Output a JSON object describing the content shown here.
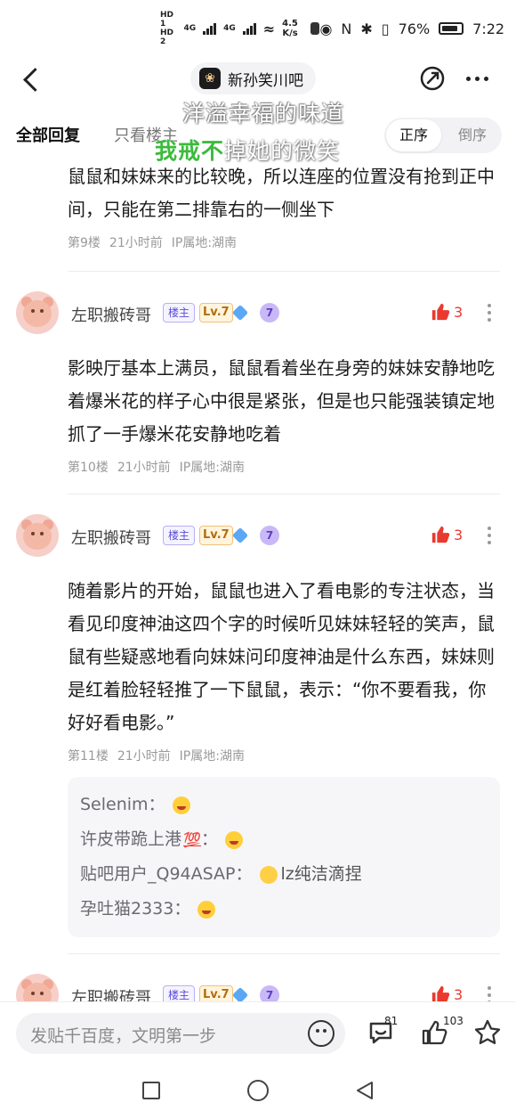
{
  "status_bar": {
    "hd1": "HD 1",
    "hd2": "HD 2",
    "net1": "4G",
    "net2": "4G",
    "speed_value": "4.5",
    "speed_unit": "K/s",
    "battery": "76%",
    "time": "7:22"
  },
  "nav": {
    "forum_name": "新孙笑川吧"
  },
  "tabs": {
    "all_replies": "全部回复",
    "only_lz": "只看楼主",
    "sort_asc": "正序",
    "sort_desc": "倒序"
  },
  "overlay": {
    "line1": "洋溢幸福的味道",
    "line2_highlight": "我戒不",
    "line2_rest": "掉她的微笑"
  },
  "posts": [
    {
      "text": "鼠鼠和妹妹来的比较晚，所以连座的位置没有抢到正中间，只能在第二排靠右的一侧坐下",
      "floor": "第9楼",
      "time": "21小时前",
      "ip": "IP属地:湖南"
    },
    {
      "username": "左职搬砖哥",
      "badge_lz": "楼主",
      "level": "Lv.7",
      "badge_seven": "7",
      "likes": "3",
      "text": "影映厅基本上满员，鼠鼠看着坐在身旁的妹妹安静地吃着爆米花的样子心中很是紧张，但是也只能强装镇定地抓了一手爆米花安静地吃着",
      "floor": "第10楼",
      "time": "21小时前",
      "ip": "IP属地:湖南"
    },
    {
      "username": "左职搬砖哥",
      "badge_lz": "楼主",
      "level": "Lv.7",
      "badge_seven": "7",
      "likes": "3",
      "text": "随着影片的开始，鼠鼠也进入了看电影的专注状态，当看见印度神油这四个字的时候听见妹妹轻轻的笑声，鼠鼠有些疑惑地看向妹妹问印度神油是什么东西，妹妹则是红着脸轻轻推了一下鼠鼠，表示：“你不要看我，你好好看电影。”",
      "floor": "第11楼",
      "time": "21小时前",
      "ip": "IP属地:湖南",
      "replies": [
        {
          "user": "Selenim：",
          "content": ""
        },
        {
          "user": "许皮带跪上港",
          "badge": "💯",
          "sep": "：",
          "content": ""
        },
        {
          "user": "贴吧用户_Q94ASAP：",
          "content": "lz纯洁滴捏"
        },
        {
          "user": "孕吐猫2333：",
          "content": ""
        }
      ]
    },
    {
      "username": "左职搬砖哥",
      "badge_lz": "楼主",
      "level": "Lv.7",
      "badge_seven": "7",
      "likes": "3"
    }
  ],
  "bottom_bar": {
    "placeholder": "发贴千百度，文明第一步",
    "comment_count": "81",
    "like_count": "103"
  },
  "colors": {
    "like_red": "#ea3a2f",
    "overlay_green": "#3cbb3c",
    "lz_badge": "#5b4bd6",
    "level_badge": "#b46c10"
  },
  "icons": [
    "back-icon",
    "share-icon",
    "more-icon",
    "like-icon",
    "emoji-icon",
    "comment-icon",
    "thumb-up-icon",
    "star-icon"
  ]
}
